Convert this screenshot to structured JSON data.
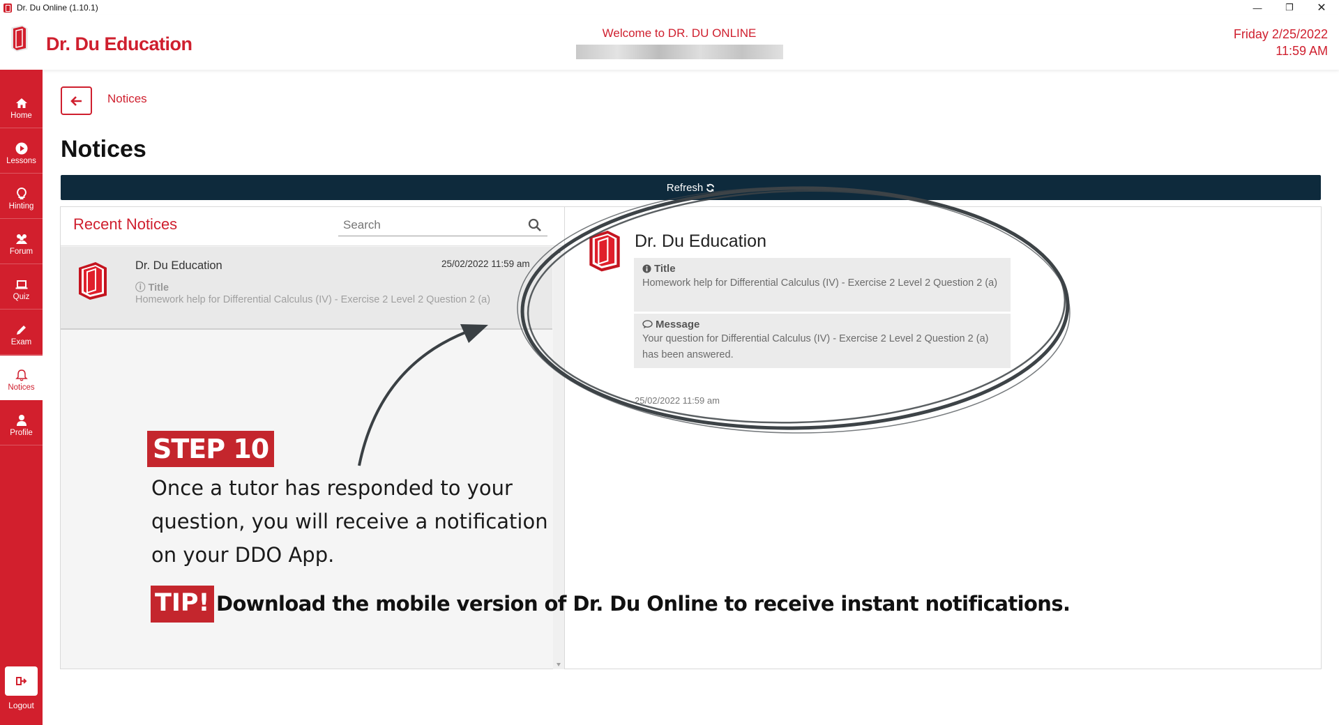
{
  "window": {
    "title": "Dr. Du Online (1.10.1)"
  },
  "header": {
    "brand": "Dr. Du Education",
    "welcome": "Welcome to DR. DU ONLINE",
    "date": "Friday 2/25/2022",
    "time": "11:59 AM"
  },
  "sidebar": {
    "items": [
      {
        "label": "Home",
        "icon": "home-icon"
      },
      {
        "label": "Lessons",
        "icon": "play-icon"
      },
      {
        "label": "Hinting",
        "icon": "lightbulb-icon"
      },
      {
        "label": "Forum",
        "icon": "users-icon"
      },
      {
        "label": "Quiz",
        "icon": "laptop-icon"
      },
      {
        "label": "Exam",
        "icon": "pencil-icon"
      },
      {
        "label": "Notices",
        "icon": "bell-icon",
        "active": true
      },
      {
        "label": "Profile",
        "icon": "user-icon"
      }
    ],
    "logout": "Logout"
  },
  "page": {
    "breadcrumb": "Notices",
    "title": "Notices",
    "refresh": "Refresh"
  },
  "list": {
    "title": "Recent Notices",
    "search_placeholder": "Search",
    "items": [
      {
        "sender": "Dr. Du Education",
        "date": "25/02/2022 11:59 am",
        "title_label": "Title",
        "title": "Homework help for Differential Calculus (IV) - Exercise 2 Level 2 Question 2 (a)"
      }
    ]
  },
  "detail": {
    "sender": "Dr. Du Education",
    "title_label": "Title",
    "title": "Homework help for Differential Calculus (IV) - Exercise 2 Level 2 Question 2 (a)",
    "message_label": "Message",
    "message": "Your question for Differential Calculus (IV) - Exercise 2 Level 2 Question 2 (a) has been answered.",
    "date": "25/02/2022 11:59 am"
  },
  "overlay": {
    "step_badge": "STEP 10",
    "step_text": "Once a tutor has responded to your question, you will receive a notification on your DDO App.",
    "tip_badge": "TIP!",
    "tip_text": "Download the mobile version of Dr. Du Online to receive instant notifications."
  },
  "colors": {
    "brand_red": "#cf1f2e",
    "refresh_bar": "#0e2a3c"
  }
}
